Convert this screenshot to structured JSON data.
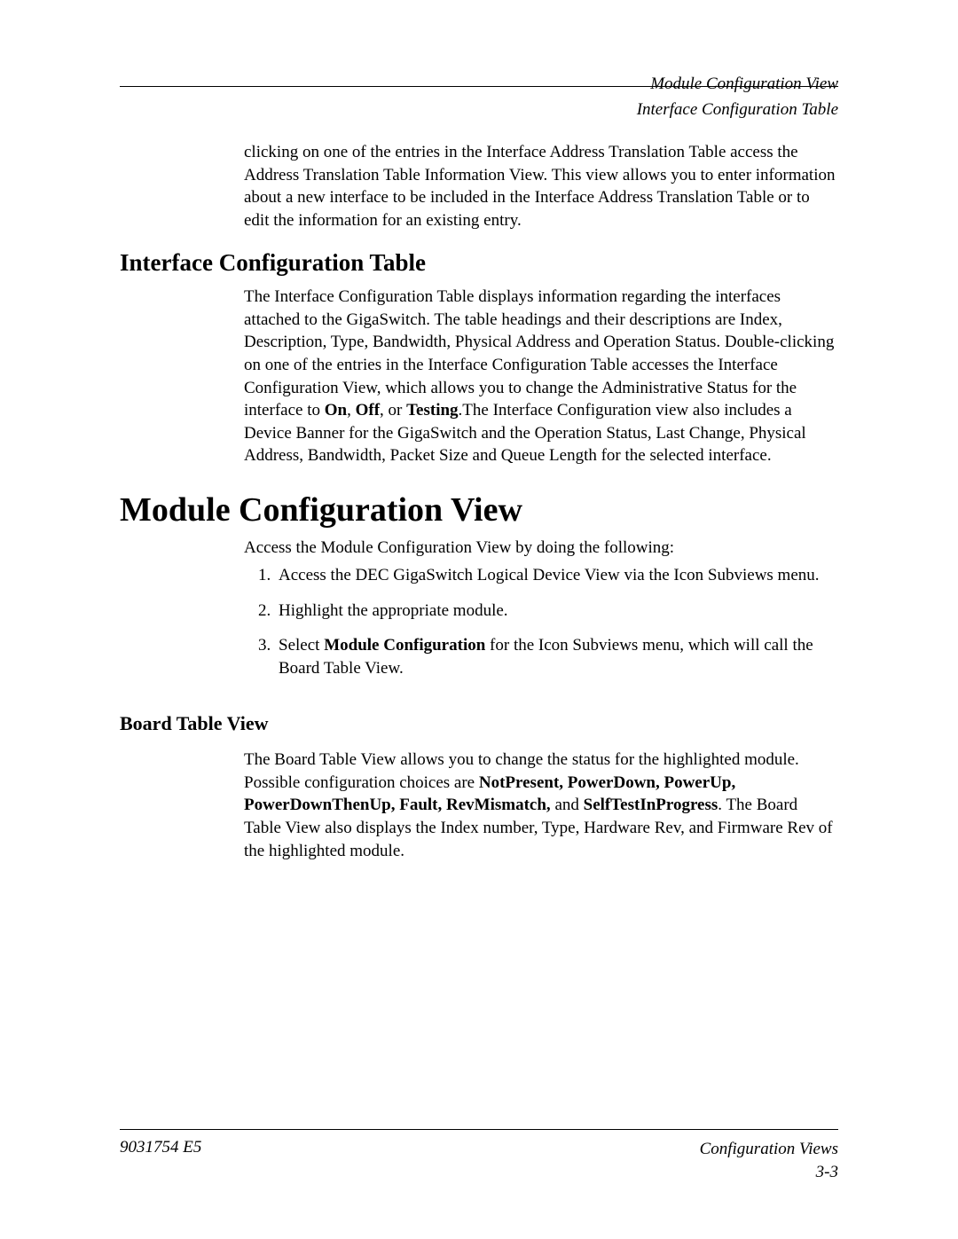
{
  "header": {
    "line1": "Module Configuration View",
    "line2": "Interface Configuration Table"
  },
  "intro_para": "clicking on one of the entries in the Interface Address Translation Table access the Address Translation Table Information View. This view allows you to enter information about a new interface to be included in the Interface Address Translation Table or to edit the information for an existing entry.",
  "section1": {
    "heading": "Interface Configuration Table",
    "para_pre": "The Interface Configuration Table displays information regarding the interfaces attached to the GigaSwitch. The table headings and their descriptions are Index, Description, Type, Bandwidth, Physical Address and Operation Status. Double-clicking on one of the entries in the Interface Configuration Table accesses the Interface Configuration View, which allows you to change the Administrative Status for the interface to ",
    "bold_on": "On",
    "sep1": ", ",
    "bold_off": "Off",
    "sep2": ", or ",
    "bold_testing": "Testing",
    "para_post": ".The Interface Configuration view also includes a Device Banner for the GigaSwitch and the Operation Status, Last Change, Physical Address, Bandwidth, Packet Size and Queue Length for the selected interface."
  },
  "section2": {
    "heading": "Module Configuration View",
    "intro": "Access the Module Configuration View by doing the following:",
    "steps": [
      {
        "text": "Access the DEC GigaSwitch Logical Device View via the Icon Subviews menu."
      },
      {
        "text": "Highlight the appropriate module."
      },
      {
        "pre": "Select ",
        "bold": "Module Configuration",
        "post": " for the Icon Subviews menu, which will call the Board Table View."
      }
    ]
  },
  "section3": {
    "heading": "Board Table View",
    "pre": "The Board Table View allows you to change the status for the highlighted module. Possible configuration choices are ",
    "bold1": "NotPresent, PowerDown, PowerUp, PowerDownThenUp, Fault, RevMismatch,",
    "mid": " and ",
    "bold2": "SelfTestInProgress",
    "post": ". The Board Table View also displays the Index number, Type, Hardware Rev, and Firmware Rev of the highlighted module."
  },
  "footer": {
    "left": "9031754 E5",
    "right1": "Configuration Views",
    "right2": "3-3"
  }
}
